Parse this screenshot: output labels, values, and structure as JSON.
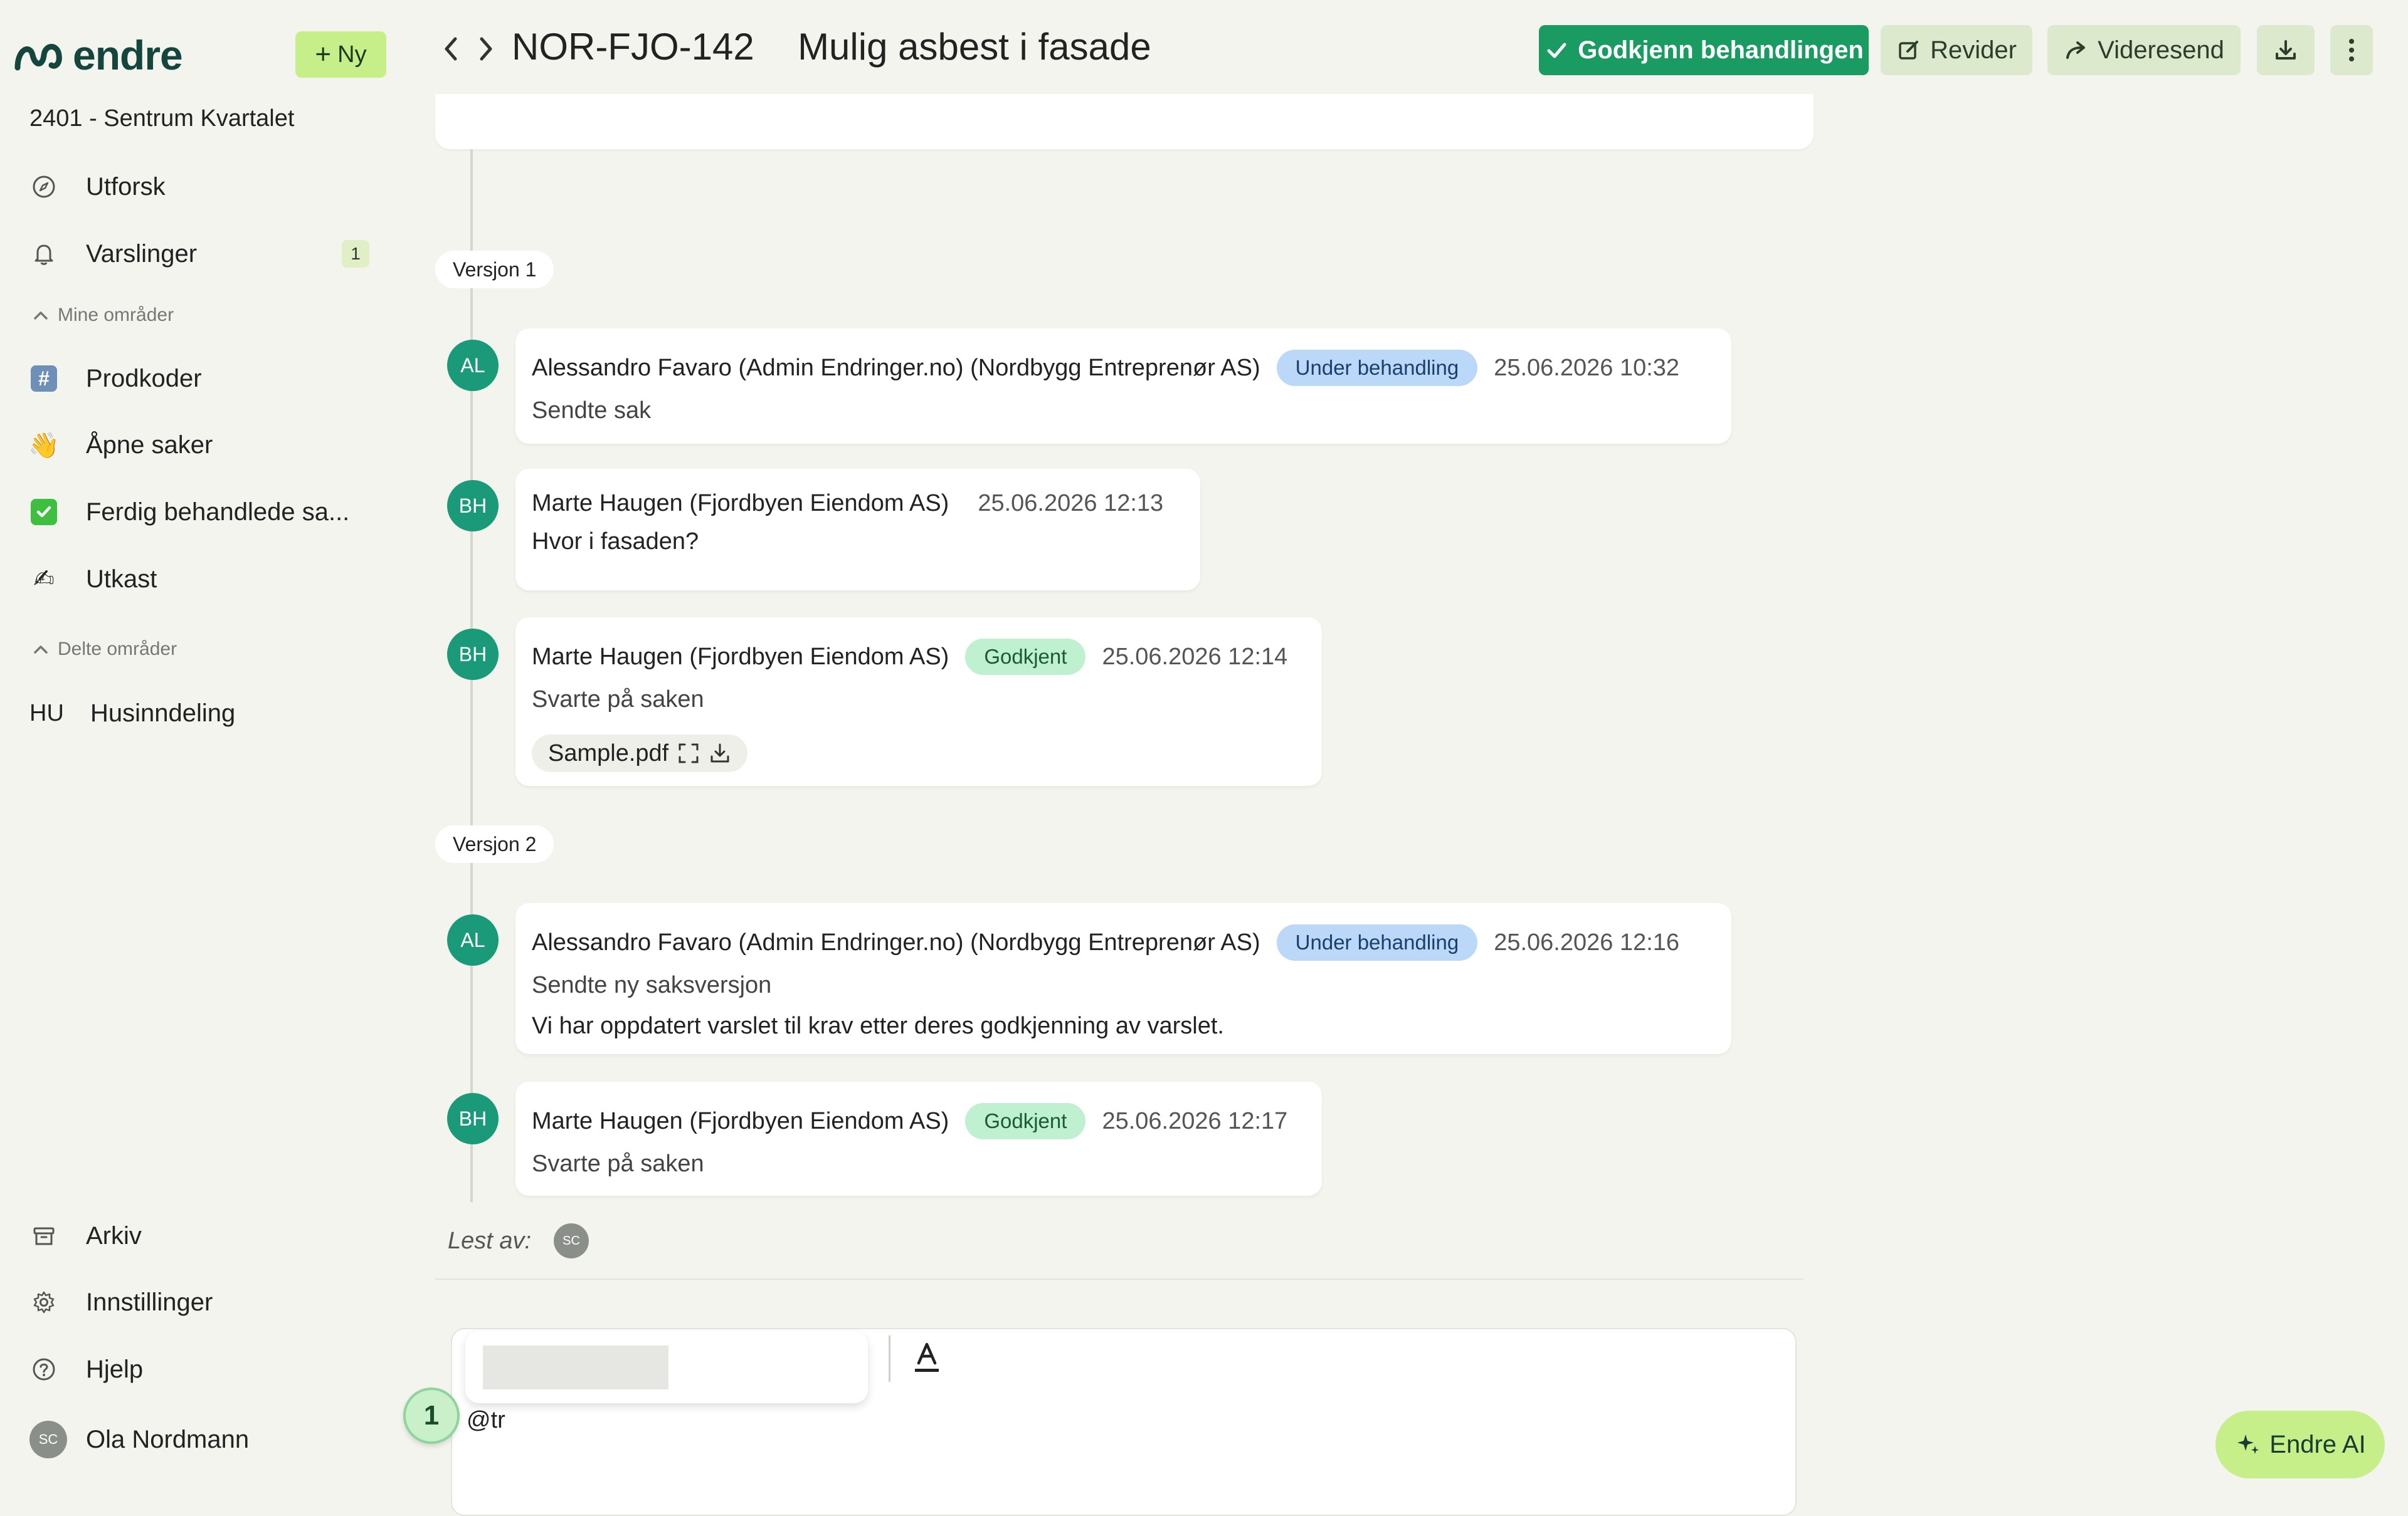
{
  "brand": {
    "name": "endre",
    "logo_color": "#15463d"
  },
  "header": {
    "new_label": "Ny",
    "case_id": "NOR-FJO-142",
    "case_title": "Mulig asbest i fasade",
    "approve_label": "Godkjenn behandlingen",
    "revise_label": "Revider",
    "forward_label": "Videresend",
    "colors": {
      "approve": "#1a9b61",
      "light": "#dde9cd",
      "accent": "#c6ef8a"
    }
  },
  "sidebar": {
    "project": "2401 - Sentrum Kvartalet",
    "explore": "Utforsk",
    "notifications": "Varslinger",
    "notifications_count": "1",
    "my_areas_label": "Mine områder",
    "my_areas": [
      {
        "icon": "hash-icon",
        "label": "Prodkoder"
      },
      {
        "icon": "waving-hand-icon",
        "label": "Åpne saker"
      },
      {
        "icon": "check-box-icon",
        "label": "Ferdig behandlede sa..."
      },
      {
        "icon": "writing-hand-icon",
        "label": "Utkast"
      }
    ],
    "shared_areas_label": "Delte områder",
    "shared_areas": [
      {
        "prefix": "HU",
        "label": "Husinndeling"
      }
    ],
    "archive": "Arkiv",
    "settings": "Innstillinger",
    "help": "Hjelp",
    "user_initials": "SC",
    "user_name": "Ola Nordmann"
  },
  "timeline": {
    "version1_label": "Versjon 1",
    "version2_label": "Versjon 2",
    "messages": [
      {
        "initials": "AL",
        "author": "Alessandro Favaro (Admin Endringer.no) (Nordbygg Entreprenør AS)",
        "status": "Under behandling",
        "time": "25.06.2026 10:32",
        "sub": "Sendte sak"
      },
      {
        "initials": "BH",
        "author": "Marte Haugen (Fjordbyen Eiendom AS)",
        "time": "25.06.2026 12:13",
        "sub": "Hvor i fasaden?"
      },
      {
        "initials": "BH",
        "author": "Marte Haugen (Fjordbyen Eiendom AS)",
        "status": "Godkjent",
        "time": "25.06.2026 12:14",
        "sub": "Svarte på saken",
        "attachment": "Sample.pdf"
      },
      {
        "initials": "AL",
        "author": "Alessandro Favaro (Admin Endringer.no) (Nordbygg Entreprenør AS)",
        "status": "Under behandling",
        "time": "25.06.2026 12:16",
        "sub": "Sendte ny saksversjon",
        "body": "Vi har oppdatert varslet til krav etter deres godkjenning av varslet."
      },
      {
        "initials": "BH",
        "author": "Marte Haugen (Fjordbyen Eiendom AS)",
        "status": "Godkjent",
        "time": "25.06.2026 12:17",
        "sub": "Svarte på saken"
      }
    ],
    "read_by_label": "Lest av:",
    "read_by_initials": "SC"
  },
  "composer": {
    "text": "@tr",
    "step_number": "1"
  },
  "ai_button": {
    "label": "Endre AI"
  }
}
